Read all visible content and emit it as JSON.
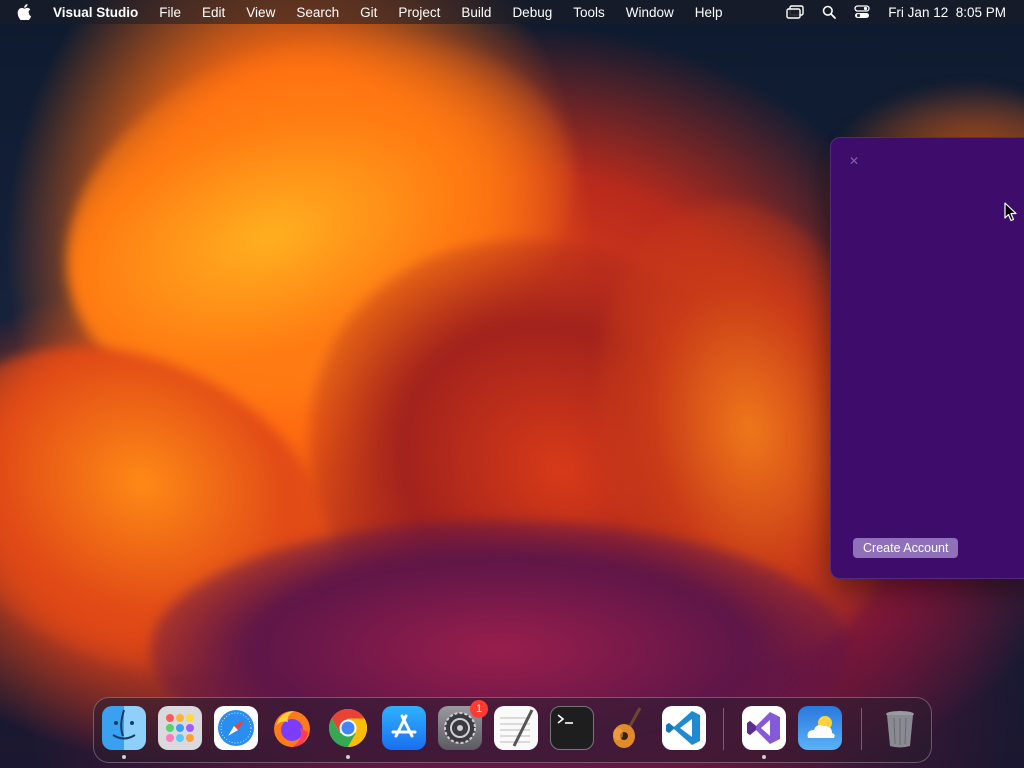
{
  "menubar": {
    "app_name": "Visual Studio",
    "items": [
      "File",
      "Edit",
      "View",
      "Search",
      "Git",
      "Project",
      "Build",
      "Debug",
      "Tools",
      "Window",
      "Help"
    ],
    "datetime": "Fri Jan 12  8:05 PM"
  },
  "dialog": {
    "close_glyph": "✕",
    "create_account_label": "Create Account",
    "background": "#3e0d6c"
  },
  "dock": {
    "apps": [
      {
        "name": "Finder",
        "icon": "finder-icon",
        "running": true
      },
      {
        "name": "Launchpad",
        "icon": "launchpad-icon",
        "running": false
      },
      {
        "name": "Safari",
        "icon": "safari-icon",
        "running": false
      },
      {
        "name": "Firefox",
        "icon": "firefox-icon",
        "running": false
      },
      {
        "name": "Google Chrome",
        "icon": "chrome-icon",
        "running": true
      },
      {
        "name": "App Store",
        "icon": "app-store-icon",
        "running": false
      },
      {
        "name": "System Settings",
        "icon": "system-settings-icon",
        "running": false,
        "badge": "1"
      },
      {
        "name": "TextEdit",
        "icon": "textedit-icon",
        "running": false
      },
      {
        "name": "Terminal",
        "icon": "terminal-icon",
        "running": false
      },
      {
        "name": "GarageBand",
        "icon": "garageband-icon",
        "running": false
      },
      {
        "name": "Visual Studio Code",
        "icon": "vscode-icon",
        "running": false
      },
      {
        "name": "Visual Studio",
        "icon": "visual-studio-icon",
        "running": true
      },
      {
        "name": "Weather",
        "icon": "weather-icon",
        "running": false
      },
      {
        "name": "Trash",
        "icon": "trash-icon",
        "running": false
      }
    ]
  }
}
